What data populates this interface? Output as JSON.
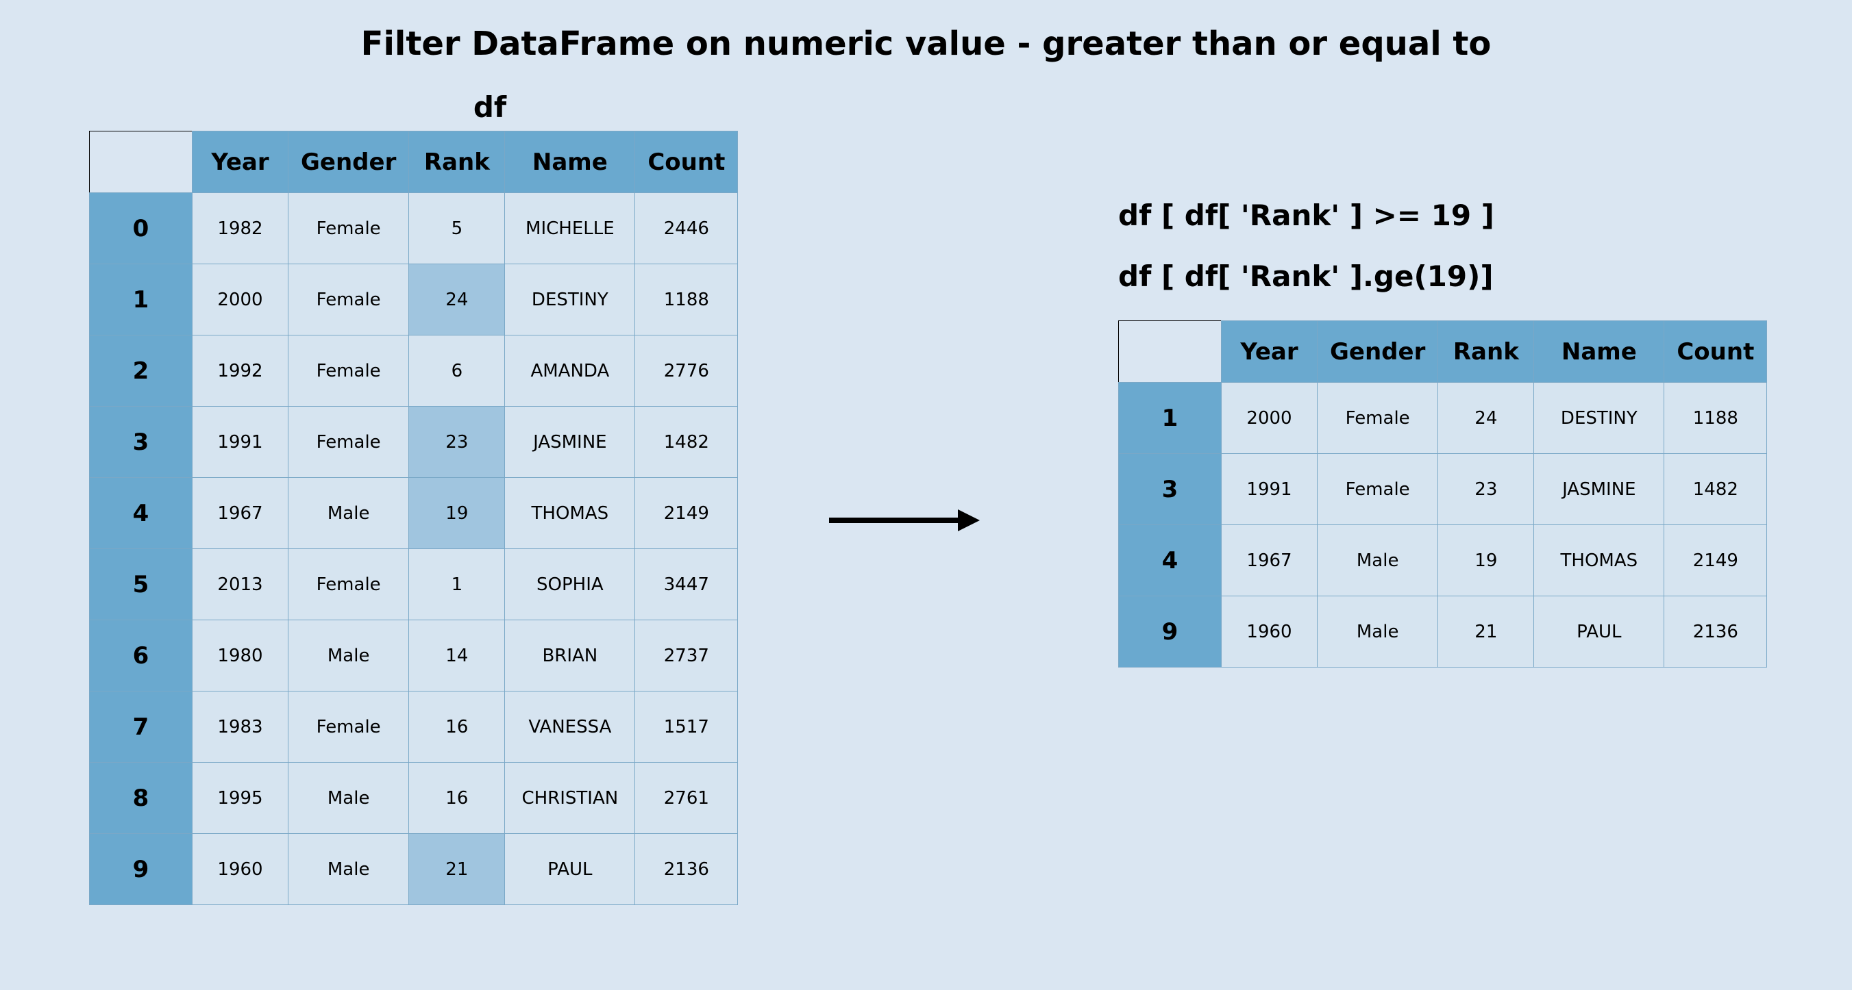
{
  "title": "Filter DataFrame on numeric value - greater than or equal to",
  "left": {
    "label": "df",
    "columns": [
      "Year",
      "Gender",
      "Rank",
      "Name",
      "Count"
    ],
    "rows": [
      {
        "idx": "0",
        "Year": "1982",
        "Gender": "Female",
        "Rank": "5",
        "Name": "MICHELLE",
        "Count": "2446",
        "hl": false
      },
      {
        "idx": "1",
        "Year": "2000",
        "Gender": "Female",
        "Rank": "24",
        "Name": "DESTINY",
        "Count": "1188",
        "hl": true
      },
      {
        "idx": "2",
        "Year": "1992",
        "Gender": "Female",
        "Rank": "6",
        "Name": "AMANDA",
        "Count": "2776",
        "hl": false
      },
      {
        "idx": "3",
        "Year": "1991",
        "Gender": "Female",
        "Rank": "23",
        "Name": "JASMINE",
        "Count": "1482",
        "hl": true
      },
      {
        "idx": "4",
        "Year": "1967",
        "Gender": "Male",
        "Rank": "19",
        "Name": "THOMAS",
        "Count": "2149",
        "hl": true
      },
      {
        "idx": "5",
        "Year": "2013",
        "Gender": "Female",
        "Rank": "1",
        "Name": "SOPHIA",
        "Count": "3447",
        "hl": false
      },
      {
        "idx": "6",
        "Year": "1980",
        "Gender": "Male",
        "Rank": "14",
        "Name": "BRIAN",
        "Count": "2737",
        "hl": false
      },
      {
        "idx": "7",
        "Year": "1983",
        "Gender": "Female",
        "Rank": "16",
        "Name": "VANESSA",
        "Count": "1517",
        "hl": false
      },
      {
        "idx": "8",
        "Year": "1995",
        "Gender": "Male",
        "Rank": "16",
        "Name": "CHRISTIAN",
        "Count": "2761",
        "hl": false
      },
      {
        "idx": "9",
        "Year": "1960",
        "Gender": "Male",
        "Rank": "21",
        "Name": "PAUL",
        "Count": "2136",
        "hl": true
      }
    ]
  },
  "right": {
    "code1": "df [ df[ 'Rank' ] >= 19 ]",
    "code2": "df [ df[ 'Rank' ].ge(19)]",
    "columns": [
      "Year",
      "Gender",
      "Rank",
      "Name",
      "Count"
    ],
    "rows": [
      {
        "idx": "1",
        "Year": "2000",
        "Gender": "Female",
        "Rank": "24",
        "Name": "DESTINY",
        "Count": "1188"
      },
      {
        "idx": "3",
        "Year": "1991",
        "Gender": "Female",
        "Rank": "23",
        "Name": "JASMINE",
        "Count": "1482"
      },
      {
        "idx": "4",
        "Year": "1967",
        "Gender": "Male",
        "Rank": "19",
        "Name": "THOMAS",
        "Count": "2149"
      },
      {
        "idx": "9",
        "Year": "1960",
        "Gender": "Male",
        "Rank": "21",
        "Name": "PAUL",
        "Count": "2136"
      }
    ]
  }
}
